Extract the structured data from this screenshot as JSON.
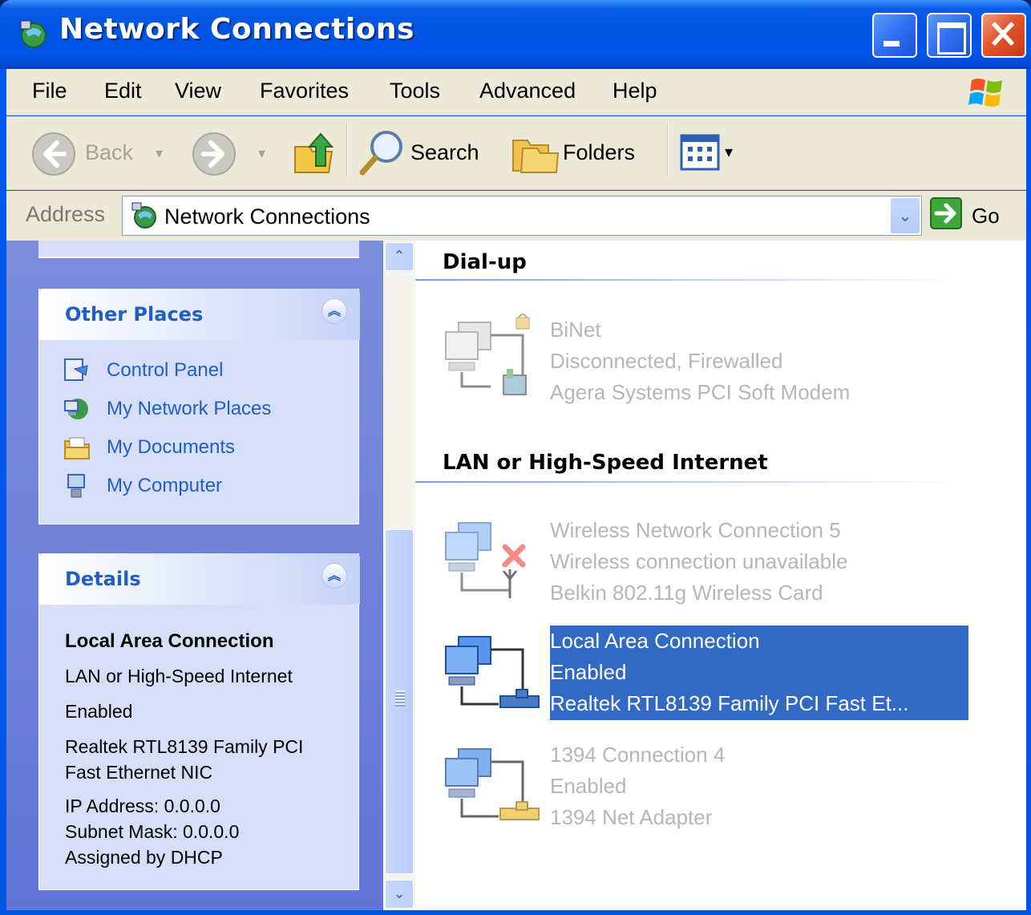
{
  "window": {
    "title": "Network Connections"
  },
  "menu": {
    "items": [
      "File",
      "Edit",
      "View",
      "Favorites",
      "Tools",
      "Advanced",
      "Help"
    ]
  },
  "toolbar": {
    "back_label": "Back",
    "search_label": "Search",
    "folders_label": "Folders"
  },
  "address": {
    "label": "Address",
    "value": "Network Connections",
    "go_label": "Go"
  },
  "other_places": {
    "title": "Other Places",
    "items": [
      "Control Panel",
      "My Network Places",
      "My Documents",
      "My Computer"
    ]
  },
  "details": {
    "title": "Details",
    "name": "Local Area Connection",
    "type": "LAN or High-Speed Internet",
    "status": "Enabled",
    "device_line1": "Realtek RTL8139 Family PCI",
    "device_line2": "Fast Ethernet NIC",
    "ip": "IP Address: 0.0.0.0",
    "subnet": "Subnet Mask: 0.0.0.0",
    "assigned": "Assigned by DHCP"
  },
  "groups": {
    "dialup": {
      "title": "Dial-up",
      "connections": [
        {
          "name": "BiNet",
          "status": "Disconnected, Firewalled",
          "device": "Agera Systems PCI Soft Modem"
        }
      ]
    },
    "lan": {
      "title": "LAN or High-Speed Internet",
      "connections": [
        {
          "name": "Wireless Network Connection 5",
          "status": "Wireless connection unavailable",
          "device": "Belkin 802.11g Wireless Card"
        },
        {
          "name": "Local Area Connection",
          "status": "Enabled",
          "device": "Realtek RTL8139 Family PCI Fast Et..."
        },
        {
          "name": "1394 Connection 4",
          "status": "Enabled",
          "device": "1394 Net Adapter"
        }
      ]
    }
  },
  "colors": {
    "titlebar": "#0054e3",
    "selection": "#316ac5",
    "link": "#215dc6",
    "taskpane": "#6375d6"
  }
}
